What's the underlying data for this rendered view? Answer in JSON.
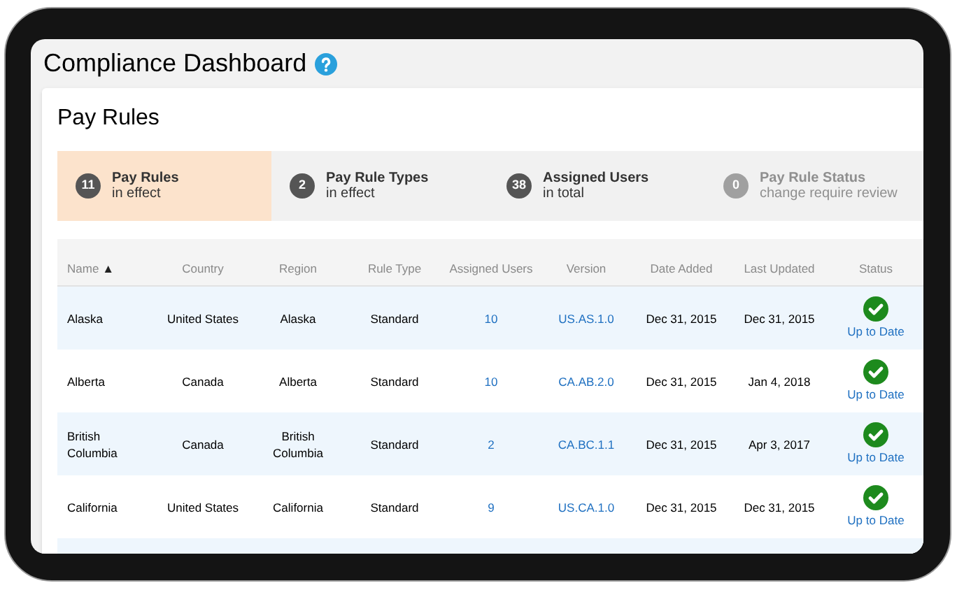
{
  "window": {
    "title": "Compliance Dashboard"
  },
  "card": {
    "title": "Pay Rules"
  },
  "stats": [
    {
      "count": "11",
      "label": "Pay Rules",
      "sub": "in effect",
      "selected": true,
      "disabled": false
    },
    {
      "count": "2",
      "label": "Pay Rule Types",
      "sub": "in effect",
      "selected": false,
      "disabled": false
    },
    {
      "count": "38",
      "label": "Assigned Users",
      "sub": "in total",
      "selected": false,
      "disabled": false
    },
    {
      "count": "0",
      "label": "Pay Rule Status",
      "sub": "change require review",
      "selected": false,
      "disabled": true
    }
  ],
  "table": {
    "columns": [
      {
        "label": "Name",
        "sort_arrow": "▲"
      },
      {
        "label": "Country"
      },
      {
        "label": "Region"
      },
      {
        "label": "Rule Type"
      },
      {
        "label": "Assigned Users"
      },
      {
        "label": "Version"
      },
      {
        "label": "Date Added"
      },
      {
        "label": "Last Updated"
      },
      {
        "label": "Status"
      }
    ],
    "rows": [
      {
        "name": "Alaska",
        "country": "United States",
        "region": "Alaska",
        "rule_type": "Standard",
        "assigned_users": "10",
        "version": "US.AS.1.0",
        "date_added": "Dec 31, 2015",
        "last_updated": "Dec 31, 2015",
        "status": {
          "kind": "ok",
          "label": "Up to Date"
        }
      },
      {
        "name": "Alberta",
        "country": "Canada",
        "region": "Alberta",
        "rule_type": "Standard",
        "assigned_users": "10",
        "version": "CA.AB.2.0",
        "date_added": "Dec 31, 2015",
        "last_updated": "Jan 4, 2018",
        "status": {
          "kind": "ok",
          "label": "Up to Date"
        }
      },
      {
        "name": "British Columbia",
        "country": "Canada",
        "region": "British Columbia",
        "rule_type": "Standard",
        "assigned_users": "2",
        "version": "CA.BC.1.1",
        "date_added": "Dec 31, 2015",
        "last_updated": "Apr 3, 2017",
        "status": {
          "kind": "ok",
          "label": "Up to Date"
        }
      },
      {
        "name": "California",
        "country": "United States",
        "region": "California",
        "rule_type": "Standard",
        "assigned_users": "9",
        "version": "US.CA.1.0",
        "date_added": "Dec 31, 2015",
        "last_updated": "Dec 31, 2015",
        "status": {
          "kind": "ok",
          "label": "Up to Date"
        }
      }
    ]
  }
}
